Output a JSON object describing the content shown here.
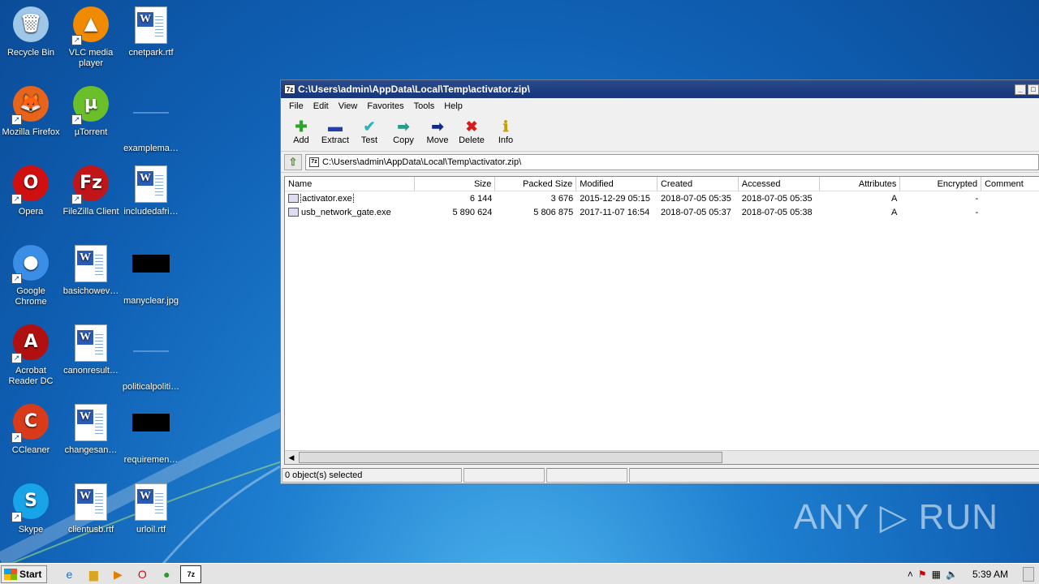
{
  "desktop": {
    "icons": [
      {
        "label": "Recycle Bin",
        "glyph": "🗑"
      },
      {
        "label": "VLC media player",
        "glyph": "▲"
      },
      {
        "label": "cnetpark.rtf"
      },
      {
        "label": "Mozilla Firefox",
        "glyph": "🦊"
      },
      {
        "label": "µTorrent",
        "glyph": "µ"
      },
      {
        "label": "examplema…"
      },
      {
        "label": "Opera",
        "glyph": "O"
      },
      {
        "label": "FileZilla Client",
        "glyph": "Fz"
      },
      {
        "label": "includedafri…"
      },
      {
        "label": "Google Chrome",
        "glyph": "●"
      },
      {
        "label": "basichowev…"
      },
      {
        "label": "manyclear.jpg"
      },
      {
        "label": "Acrobat Reader DC",
        "glyph": "A"
      },
      {
        "label": "canonresult…"
      },
      {
        "label": "politicalpoliti…"
      },
      {
        "label": "CCleaner",
        "glyph": "C"
      },
      {
        "label": "changesan…"
      },
      {
        "label": "requiremen…"
      },
      {
        "label": "Skype",
        "glyph": "S"
      },
      {
        "label": "clientusb.rtf"
      },
      {
        "label": "urloil.rtf"
      }
    ]
  },
  "window": {
    "app_icon": "7z",
    "title": "C:\\Users\\admin\\AppData\\Local\\Temp\\activator.zip\\",
    "menu": [
      "File",
      "Edit",
      "View",
      "Favorites",
      "Tools",
      "Help"
    ],
    "toolbar": [
      {
        "label": "Add",
        "glyph": "✚",
        "color": "#2aa52a"
      },
      {
        "label": "Extract",
        "glyph": "▬",
        "color": "#1f3fb0"
      },
      {
        "label": "Test",
        "glyph": "✔",
        "color": "#2bb5c0"
      },
      {
        "label": "Copy",
        "glyph": "➡",
        "color": "#2a9a8a"
      },
      {
        "label": "Move",
        "glyph": "➡",
        "color": "#0f2a8a"
      },
      {
        "label": "Delete",
        "glyph": "✖",
        "color": "#d81a1a"
      },
      {
        "label": "Info",
        "glyph": "ℹ",
        "color": "#c8a000"
      }
    ],
    "address": "C:\\Users\\admin\\AppData\\Local\\Temp\\activator.zip\\",
    "columns": [
      "Name",
      "Size",
      "Packed Size",
      "Modified",
      "Created",
      "Accessed",
      "Attributes",
      "Encrypted",
      "Comment"
    ],
    "files": [
      {
        "name": "activator.exe",
        "size": "6 144",
        "packed": "3 676",
        "modified": "2015-12-29 05:15",
        "created": "2018-07-05 05:35",
        "accessed": "2018-07-05 05:35",
        "attributes": "A",
        "encrypted": "-",
        "comment": ""
      },
      {
        "name": "usb_network_gate.exe",
        "size": "5 890 624",
        "packed": "5 806 875",
        "modified": "2017-11-07 16:54",
        "created": "2018-07-05 05:37",
        "accessed": "2018-07-05 05:38",
        "attributes": "A",
        "encrypted": "-",
        "comment": ""
      }
    ],
    "status": "0 object(s) selected"
  },
  "taskbar": {
    "start_label": "Start",
    "active_app": "7z",
    "clock": "5:39 AM"
  },
  "watermark": "ANY ▷ RUN"
}
